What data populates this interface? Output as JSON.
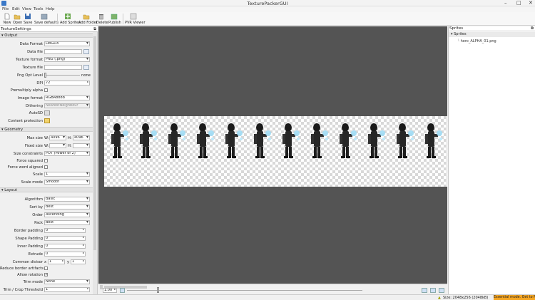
{
  "window": {
    "title": "TexturePackerGUI"
  },
  "menu": [
    "File",
    "Edit",
    "View",
    "Tools",
    "Help"
  ],
  "toolbar": {
    "new": "New",
    "open": "Open",
    "save": "Save",
    "save_defaults": "Save defaults",
    "add_sprites": "Add Sprites",
    "add_folder": "Add Folder",
    "delete": "Delete",
    "publish": "Publish",
    "pvr_viewer": "PVR Viewer"
  },
  "texture_settings": {
    "title": "TextureSettings",
    "output": {
      "section": "Output",
      "data_format_label": "Data Format",
      "data_format_value": "LibGDX",
      "data_file_label": "Data file",
      "data_file_value": "",
      "texture_format_label": "Texture format",
      "texture_format_value": "PNG (.png)",
      "texture_file_label": "Texture file",
      "texture_file_value": "",
      "png_opt_label": "Png Opt Level",
      "png_opt_value": "none",
      "premultiply_label": "Premultiply alpha",
      "dpi_label": "DPI",
      "dpi_value": "72",
      "image_format_label": "Image format",
      "image_format_value": "RGBA8888",
      "dithering_label": "Dithering",
      "dithering_value": "NearestNeighbour",
      "autosd_label": "AutoSD",
      "content_protection_label": "Content protection"
    },
    "geometry": {
      "section": "Geometry",
      "max_size_label": "Max size",
      "w_label": "W:",
      "h_label": "H:",
      "max_w": "4096",
      "max_h": "4096",
      "fixed_size_label": "Fixed size",
      "fixed_w": "",
      "fixed_h": "",
      "size_constraints_label": "Size constraints",
      "size_constraints_value": "POT (Power of 2)",
      "force_squared_label": "Force squared",
      "force_word_aligned_label": "Force word aligned",
      "scale_label": "Scale",
      "scale_value": "1",
      "scale_mode_label": "Scale mode",
      "scale_mode_value": "Smooth"
    },
    "layout": {
      "section": "Layout",
      "algorithm_label": "Algorithm",
      "algorithm_value": "Basic",
      "sort_by_label": "Sort by",
      "sort_by_value": "Best",
      "order_label": "Order",
      "order_value": "Ascending",
      "pack_label": "Pack",
      "pack_value": "Best",
      "border_padding_label": "Border padding",
      "border_padding_value": "0",
      "shape_padding_label": "Shape Padding",
      "shape_padding_value": "0",
      "inner_padding_label": "Inner Padding",
      "inner_padding_value": "0",
      "extrude_label": "Extrude",
      "extrude_value": "0",
      "common_divisor_label": "Common divisor",
      "x_label": "x",
      "y_label": "y",
      "cd_x": "1",
      "cd_y": "1",
      "reduce_border_label": "Reduce border artifacts",
      "allow_rotation_label": "Allow rotation",
      "trim_mode_label": "Trim mode",
      "trim_mode_value": "None",
      "trim_threshold_label": "Trim / Crop Threshold",
      "trim_threshold_value": "1"
    }
  },
  "sprites": {
    "title": "Sprites",
    "root": "Sprites",
    "item": "hero_ALPHA_01.png"
  },
  "viewer": {
    "zoom": "1.00"
  },
  "status": {
    "size": "Size: 2048x256 (2048kB)",
    "badge": "Essential mode. Get to Pro"
  }
}
